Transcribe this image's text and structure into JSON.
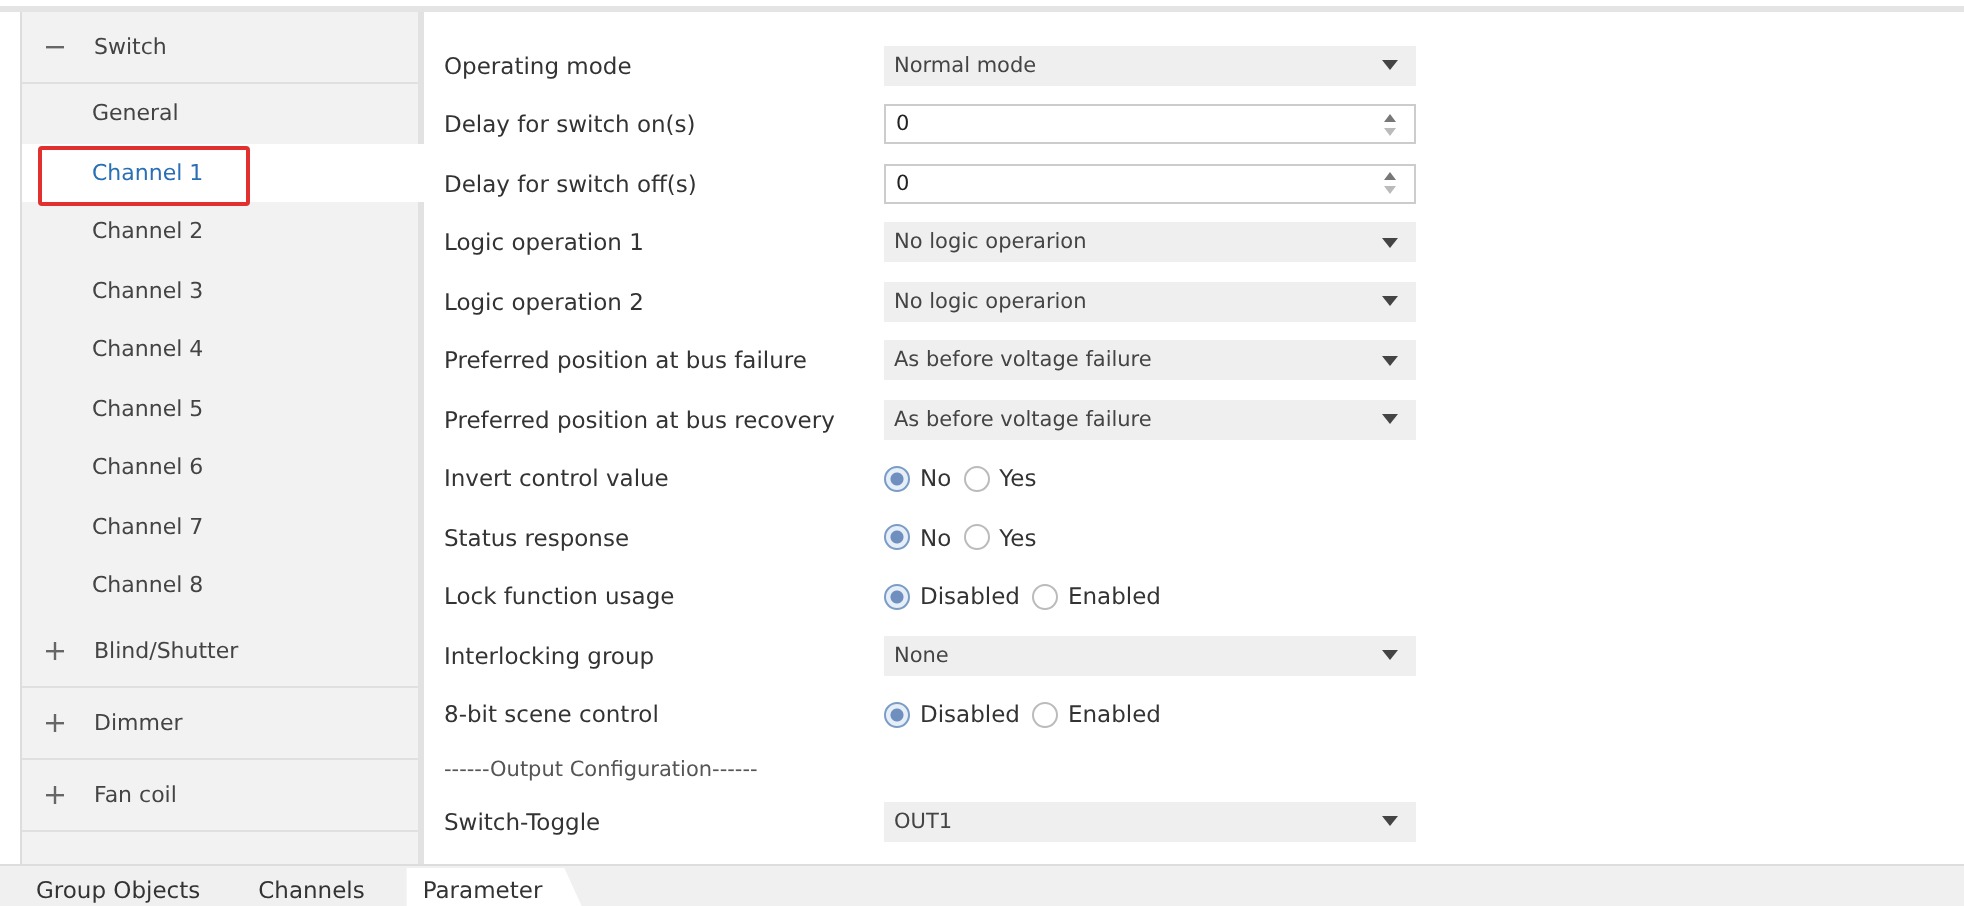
{
  "sidebar": {
    "groups": [
      {
        "label": "Switch",
        "expanded": true,
        "items": [
          {
            "label": "General",
            "selected": false,
            "highlighted": false
          },
          {
            "label": "Channel 1",
            "selected": true,
            "highlighted": true
          },
          {
            "label": "Channel 2",
            "selected": false,
            "highlighted": false
          },
          {
            "label": "Channel 3",
            "selected": false,
            "highlighted": false
          },
          {
            "label": "Channel 4",
            "selected": false,
            "highlighted": false
          },
          {
            "label": "Channel 5",
            "selected": false,
            "highlighted": false
          },
          {
            "label": "Channel 6",
            "selected": false,
            "highlighted": false
          },
          {
            "label": "Channel 7",
            "selected": false,
            "highlighted": false
          },
          {
            "label": "Channel 8",
            "selected": false,
            "highlighted": false
          }
        ]
      },
      {
        "label": "Blind/Shutter",
        "expanded": false
      },
      {
        "label": "Dimmer",
        "expanded": false
      },
      {
        "label": "Fan coil",
        "expanded": false
      }
    ]
  },
  "parameters": [
    {
      "kind": "select",
      "label": "Operating mode",
      "value": "Normal mode"
    },
    {
      "kind": "spin",
      "label": "Delay for switch on(s)",
      "value": "0"
    },
    {
      "kind": "spin",
      "label": "Delay for switch off(s)",
      "value": "0"
    },
    {
      "kind": "select",
      "label": "Logic operation 1",
      "value": "No logic operarion"
    },
    {
      "kind": "select",
      "label": "Logic operation 2",
      "value": "No logic operarion"
    },
    {
      "kind": "select",
      "label": "Preferred position at bus failure",
      "value": "As before voltage failure"
    },
    {
      "kind": "select",
      "label": "Preferred position at bus recovery",
      "value": "As before voltage failure"
    },
    {
      "kind": "radio",
      "label": "Invert control value",
      "options": [
        {
          "label": "No",
          "selected": true
        },
        {
          "label": "Yes",
          "selected": false
        }
      ]
    },
    {
      "kind": "radio",
      "label": "Status response",
      "options": [
        {
          "label": "No",
          "selected": true
        },
        {
          "label": "Yes",
          "selected": false
        }
      ]
    },
    {
      "kind": "radio",
      "label": "Lock function usage",
      "options": [
        {
          "label": "Disabled",
          "selected": true
        },
        {
          "label": "Enabled",
          "selected": false
        }
      ]
    },
    {
      "kind": "select",
      "label": "Interlocking group",
      "value": "None"
    },
    {
      "kind": "radio",
      "label": "8-bit scene control",
      "options": [
        {
          "label": "Disabled",
          "selected": true
        },
        {
          "label": "Enabled",
          "selected": false
        }
      ]
    },
    {
      "kind": "heading",
      "label": "------Output Configuration------"
    },
    {
      "kind": "select",
      "label": "Switch-Toggle",
      "value": "OUT1"
    }
  ],
  "tabs": [
    {
      "label": "Group Objects",
      "selected": false
    },
    {
      "label": "Channels",
      "selected": false
    },
    {
      "label": "Parameter",
      "selected": true
    }
  ]
}
